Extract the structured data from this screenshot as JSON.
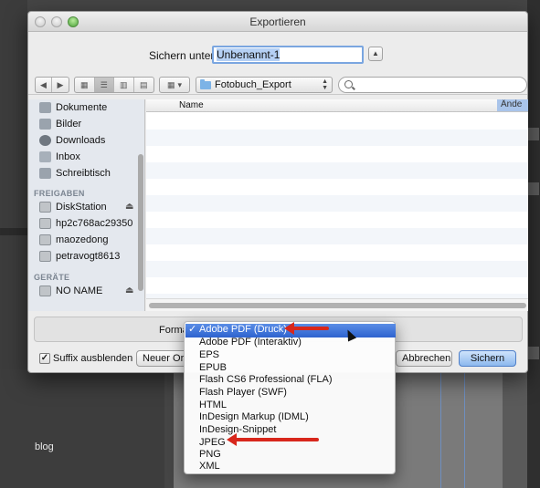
{
  "window": {
    "title": "Exportieren"
  },
  "save": {
    "label": "Sichern unter:",
    "filename": "Unbenannt-1"
  },
  "toolbar": {
    "current_folder": "Fotobuch_Export"
  },
  "sidebar": {
    "favorites": [
      "Dokumente",
      "Bilder",
      "Downloads",
      "Inbox",
      "Schreibtisch"
    ],
    "shared_header": "FREIGABEN",
    "shared": [
      "DiskStation",
      "hp2c768ac29350",
      "maozedong",
      "petravogt8613"
    ],
    "devices_header": "GERÄTE",
    "devices": [
      "NO NAME"
    ]
  },
  "filelist": {
    "columns": [
      "Name",
      "Ände"
    ]
  },
  "format": {
    "label": "Format",
    "options": [
      "Adobe PDF (Druck)",
      "Adobe PDF (Interaktiv)",
      "EPS",
      "EPUB",
      "Flash CS6 Professional (FLA)",
      "Flash Player (SWF)",
      "HTML",
      "InDesign Markup (IDML)",
      "InDesign-Snippet",
      "JPEG",
      "PNG",
      "XML"
    ],
    "selected": "Adobe PDF (Druck)",
    "check_mark": "✓"
  },
  "bottom": {
    "hide_extension_label": "Suffix ausblenden",
    "hide_extension_checked": true,
    "new_folder": "Neuer Ordner",
    "cancel": "Abbrechen",
    "save": "Sichern"
  },
  "background": {
    "caption": "blog"
  },
  "colors": {
    "annotation_arrow": "#d8271c",
    "selection": "#2e63cf",
    "default_button": "#8cb8ee"
  }
}
